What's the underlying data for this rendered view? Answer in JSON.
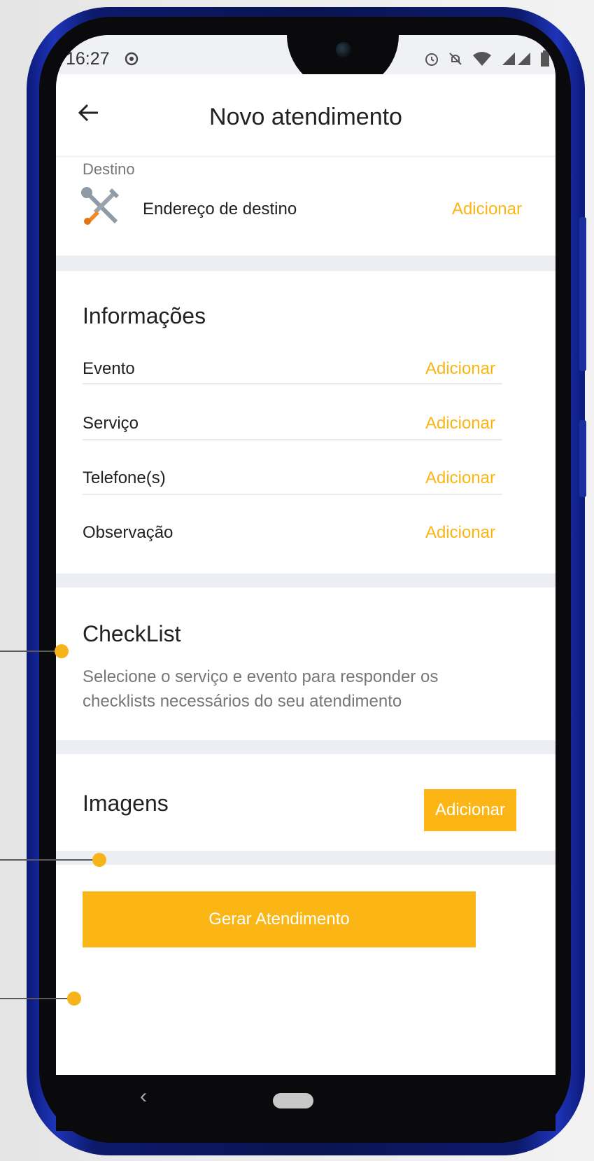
{
  "status_bar": {
    "time": "16:27"
  },
  "header": {
    "title": "Novo atendimento"
  },
  "destino": {
    "label": "Destino",
    "address_label": "Endereço de destino",
    "action": "Adicionar"
  },
  "informacoes": {
    "title": "Informações",
    "rows": [
      {
        "label": "Evento",
        "action": "Adicionar"
      },
      {
        "label": "Serviço",
        "action": "Adicionar"
      },
      {
        "label": "Telefone(s)",
        "action": "Adicionar"
      },
      {
        "label": "Observação",
        "action": "Adicionar"
      }
    ]
  },
  "checklist": {
    "title": "CheckList",
    "description": "Selecione o serviço e evento para responder os checklists necessários do seu atendimento"
  },
  "imagens": {
    "title": "Imagens",
    "action": "Adicionar"
  },
  "footer": {
    "submit_label": "Gerar Atendimento"
  },
  "colors": {
    "accent": "#fbb515",
    "phone_frame": "#1b2f9e",
    "background": "#ffffff"
  },
  "icons": [
    "sync-icon",
    "alarm-icon",
    "mute-icon",
    "wifi-icon",
    "signal-icon",
    "battery-icon",
    "back-arrow-icon",
    "wrench-icon"
  ]
}
